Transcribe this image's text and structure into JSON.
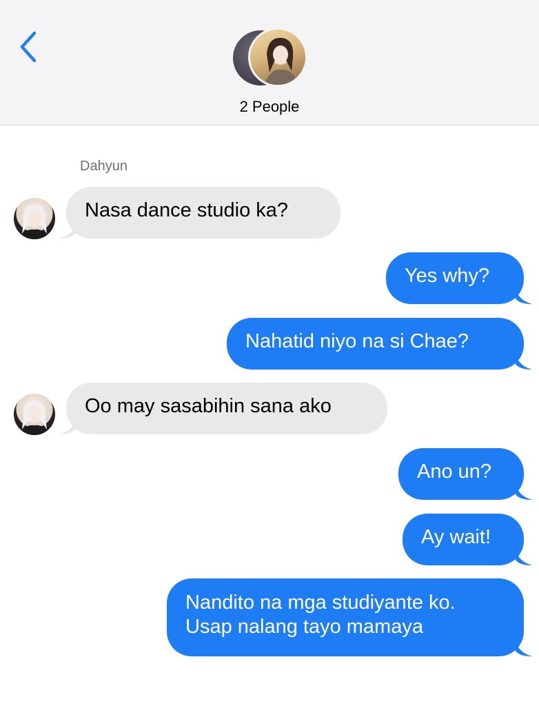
{
  "header": {
    "title": "2 People"
  },
  "thread": {
    "sender_name": "Dahyun",
    "messages": [
      {
        "direction": "incoming",
        "text": "Nasa dance studio ka?"
      },
      {
        "direction": "outgoing",
        "text": "Yes why?"
      },
      {
        "direction": "outgoing",
        "text": "Nahatid niyo na si Chae?"
      },
      {
        "direction": "incoming",
        "text": "Oo may sasabihin sana ako"
      },
      {
        "direction": "outgoing",
        "text": "Ano un?"
      },
      {
        "direction": "outgoing",
        "text": "Ay wait!"
      },
      {
        "direction": "outgoing",
        "lines": [
          "Nandito na mga studiyante ko.",
          "Usap nalang tayo mamaya"
        ]
      }
    ]
  },
  "colors": {
    "header_bg": "#f4f4f6",
    "accent": "#1e7cf5",
    "incoming_bubble": "#e9e9eb"
  },
  "icons": {
    "back": "chevron-left-icon"
  }
}
